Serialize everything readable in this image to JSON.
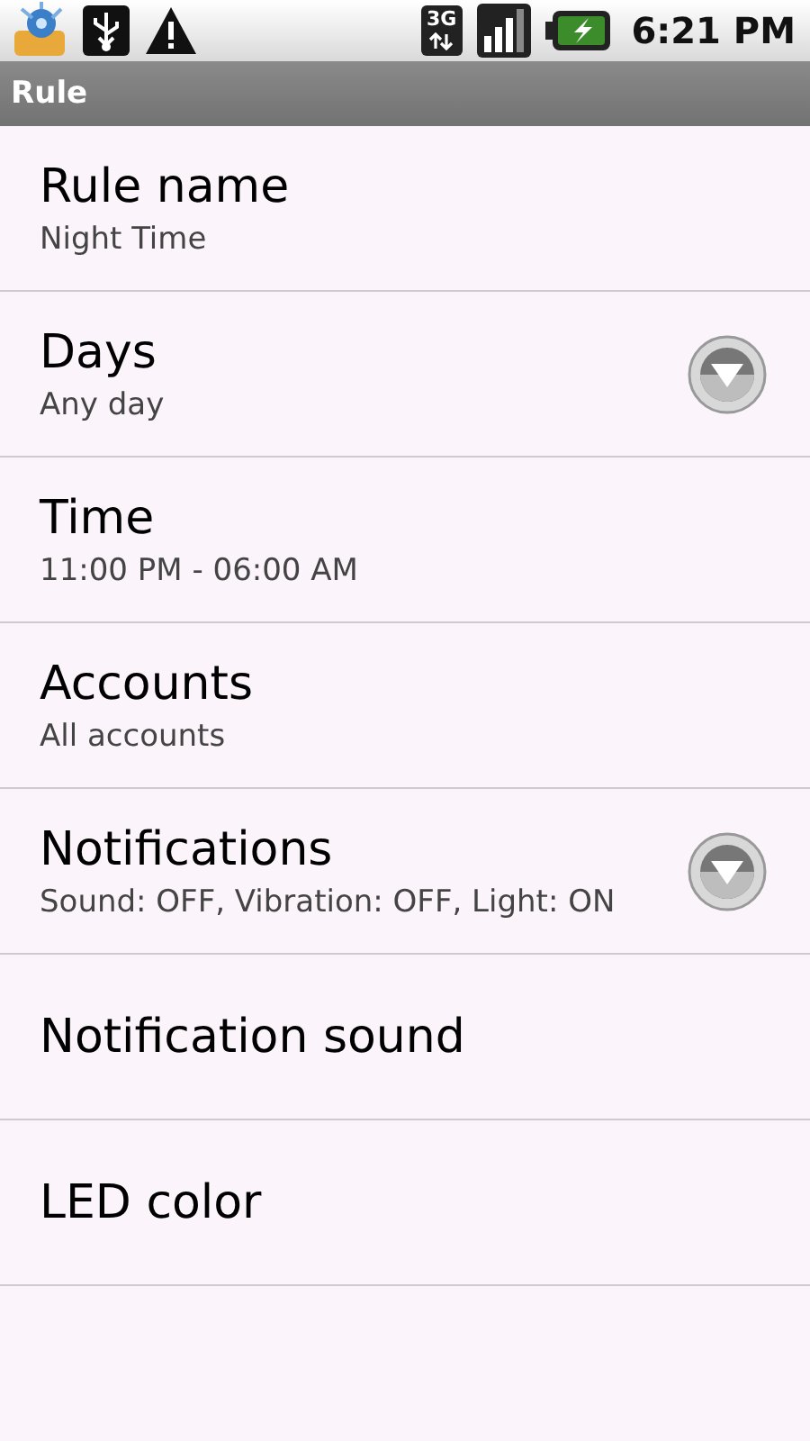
{
  "status_bar": {
    "network_type": "3G",
    "time": "6:21 PM"
  },
  "title_bar": {
    "title": "Rule"
  },
  "settings": [
    {
      "title": "Rule name",
      "summary": "Night Time",
      "dropdown": false
    },
    {
      "title": "Days",
      "summary": "Any day",
      "dropdown": true
    },
    {
      "title": "Time",
      "summary": "11:00 PM - 06:00 AM",
      "dropdown": false
    },
    {
      "title": "Accounts",
      "summary": "All accounts",
      "dropdown": false
    },
    {
      "title": "Notifications",
      "summary": "Sound: OFF, Vibration: OFF, Light: ON",
      "dropdown": true
    },
    {
      "title": "Notification sound",
      "dropdown": false
    },
    {
      "title": "LED color",
      "dropdown": false
    }
  ]
}
